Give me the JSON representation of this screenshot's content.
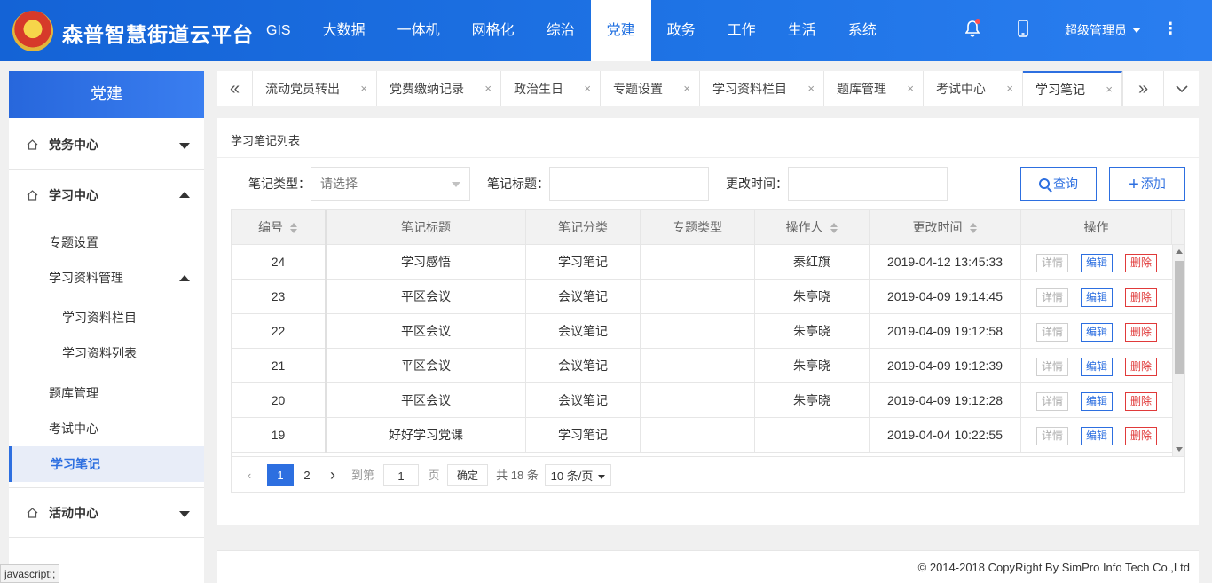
{
  "header": {
    "brand": "森普智慧街道云平台",
    "nav": [
      "GIS",
      "大数据",
      "一体机",
      "网格化",
      "综治",
      "党建",
      "政务",
      "工作",
      "生活",
      "系统"
    ],
    "active_nav_index": 5,
    "user": "超级管理员"
  },
  "sidebar": {
    "title": "党建",
    "groups": {
      "party_center": "党务中心",
      "study_center": "学习中心",
      "activity_center": "活动中心"
    },
    "study_items": {
      "topic_settings": "专题设置",
      "material_mgmt": "学习资料管理",
      "material_column": "学习资料栏目",
      "material_list": "学习资料列表",
      "question_bank": "题库管理",
      "exam_center": "考试中心",
      "study_notes": "学习笔记"
    }
  },
  "tabs": [
    "流动党员转出",
    "党费缴纳记录",
    "政治生日",
    "专题设置",
    "学习资料栏目",
    "题库管理",
    "考试中心",
    "学习笔记"
  ],
  "tab_close": "×",
  "panel": {
    "title": "学习笔记列表",
    "filters": {
      "type_label": "笔记类型：",
      "type_placeholder": "请选择",
      "title_label": "笔记标题：",
      "time_label": "更改时间："
    },
    "query_button": "查询",
    "add_button": "添加"
  },
  "table": {
    "headers": [
      "编号",
      "笔记标题",
      "笔记分类",
      "专题类型",
      "操作人",
      "更改时间",
      "操作"
    ],
    "rows": [
      {
        "id": "24",
        "title": "学习感悟",
        "category": "学习笔记",
        "topic": "",
        "operator": "秦红旗",
        "time": "2019-04-12 13:45:33"
      },
      {
        "id": "23",
        "title": "平区会议",
        "category": "会议笔记",
        "topic": "",
        "operator": "朱亭晓",
        "time": "2019-04-09 19:14:45"
      },
      {
        "id": "22",
        "title": "平区会议",
        "category": "会议笔记",
        "topic": "",
        "operator": "朱亭晓",
        "time": "2019-04-09 19:12:58"
      },
      {
        "id": "21",
        "title": "平区会议",
        "category": "会议笔记",
        "topic": "",
        "operator": "朱亭晓",
        "time": "2019-04-09 19:12:39"
      },
      {
        "id": "20",
        "title": "平区会议",
        "category": "会议笔记",
        "topic": "",
        "operator": "朱亭晓",
        "time": "2019-04-09 19:12:28"
      },
      {
        "id": "19",
        "title": "好好学习党课",
        "category": "学习笔记",
        "topic": "",
        "operator": "",
        "time": "2019-04-04 10:22:55"
      }
    ],
    "actions": {
      "detail": "详情",
      "edit": "编辑",
      "delete": "删除"
    }
  },
  "pagination": {
    "pages": [
      "1",
      "2"
    ],
    "goto_label": "到第",
    "goto_value": "1",
    "page_unit": "页",
    "confirm": "确定",
    "total": "共 18 条",
    "page_size": "10 条/页"
  },
  "footer": {
    "copyright": "© 2014-2018 CopyRight By SimPro Info Tech Co.,Ltd"
  },
  "status_bar": "javascript:;"
}
